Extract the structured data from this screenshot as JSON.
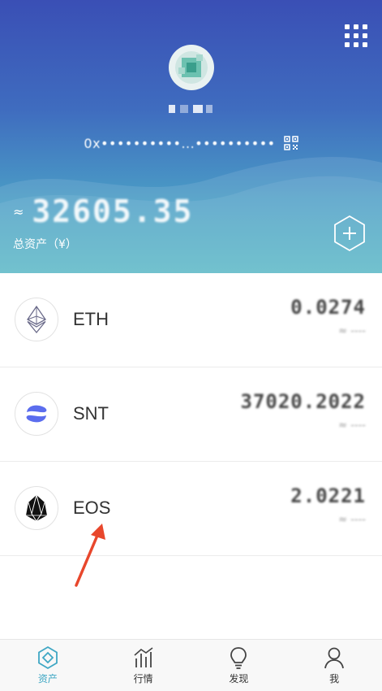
{
  "header": {
    "wallet_name": "••••",
    "address": "0x••••••••••...••••••••••",
    "approx_symbol": "≈",
    "balance": "32605.35",
    "total_label": "总资产（¥）"
  },
  "assets": [
    {
      "symbol": "ETH",
      "amount": "0.0274",
      "sub": "≈ ----"
    },
    {
      "symbol": "SNT",
      "amount": "37020.2022",
      "sub": "≈ ----"
    },
    {
      "symbol": "EOS",
      "amount": "2.0221",
      "sub": "≈ ----"
    }
  ],
  "nav": {
    "items": [
      {
        "label": "资产",
        "icon": "assets-icon",
        "active": true
      },
      {
        "label": "行情",
        "icon": "market-icon",
        "active": false
      },
      {
        "label": "发现",
        "icon": "discover-icon",
        "active": false
      },
      {
        "label": "我",
        "icon": "profile-icon",
        "active": false
      }
    ]
  },
  "colors": {
    "accent": "#3fa7c4",
    "header_top": "#3a4fb5",
    "header_bottom": "#55b6c4",
    "annotation": "#e8472c"
  }
}
